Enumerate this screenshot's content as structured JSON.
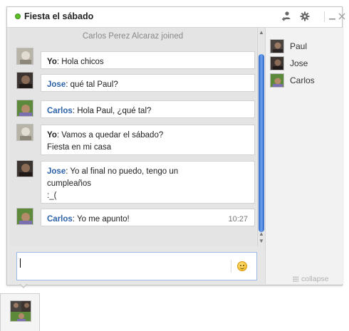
{
  "window": {
    "title": "Fiesta el sábado",
    "status": "online",
    "header_icons": [
      "add-person-icon",
      "gear-icon",
      "minimize-icon",
      "close-icon"
    ]
  },
  "chat": {
    "system_message": "Carlos Perez Alcaraz joined",
    "messages": [
      {
        "author": "Yo",
        "lines": [
          "Hola chicos"
        ],
        "time": ""
      },
      {
        "author": "Jose",
        "lines": [
          "qué tal Paul?"
        ],
        "time": ""
      },
      {
        "author": "Carlos",
        "lines": [
          "Hola Paul, ¿qué tal?"
        ],
        "time": ""
      },
      {
        "author": "Yo",
        "lines": [
          "Vamos a quedar el sábado?",
          "Fiesta en mi casa"
        ],
        "time": ""
      },
      {
        "author": "Jose",
        "lines": [
          "Yo al final no puedo, tengo un",
          "cumpleaños",
          ":_("
        ],
        "time": ""
      },
      {
        "author": "Carlos",
        "lines": [
          "Yo me apunto!"
        ],
        "time": "10:27"
      }
    ]
  },
  "participants": [
    {
      "name": "Paul"
    },
    {
      "name": "Jose"
    },
    {
      "name": "Carlos"
    }
  ],
  "collapse_label": "collapse",
  "input": {
    "value": "",
    "placeholder": ""
  },
  "colors": {
    "status_online": "#5cbf2a",
    "name_blue": "#2d62a8",
    "scroll_thumb": "#3a73d0",
    "input_border": "#9bbbe6"
  }
}
